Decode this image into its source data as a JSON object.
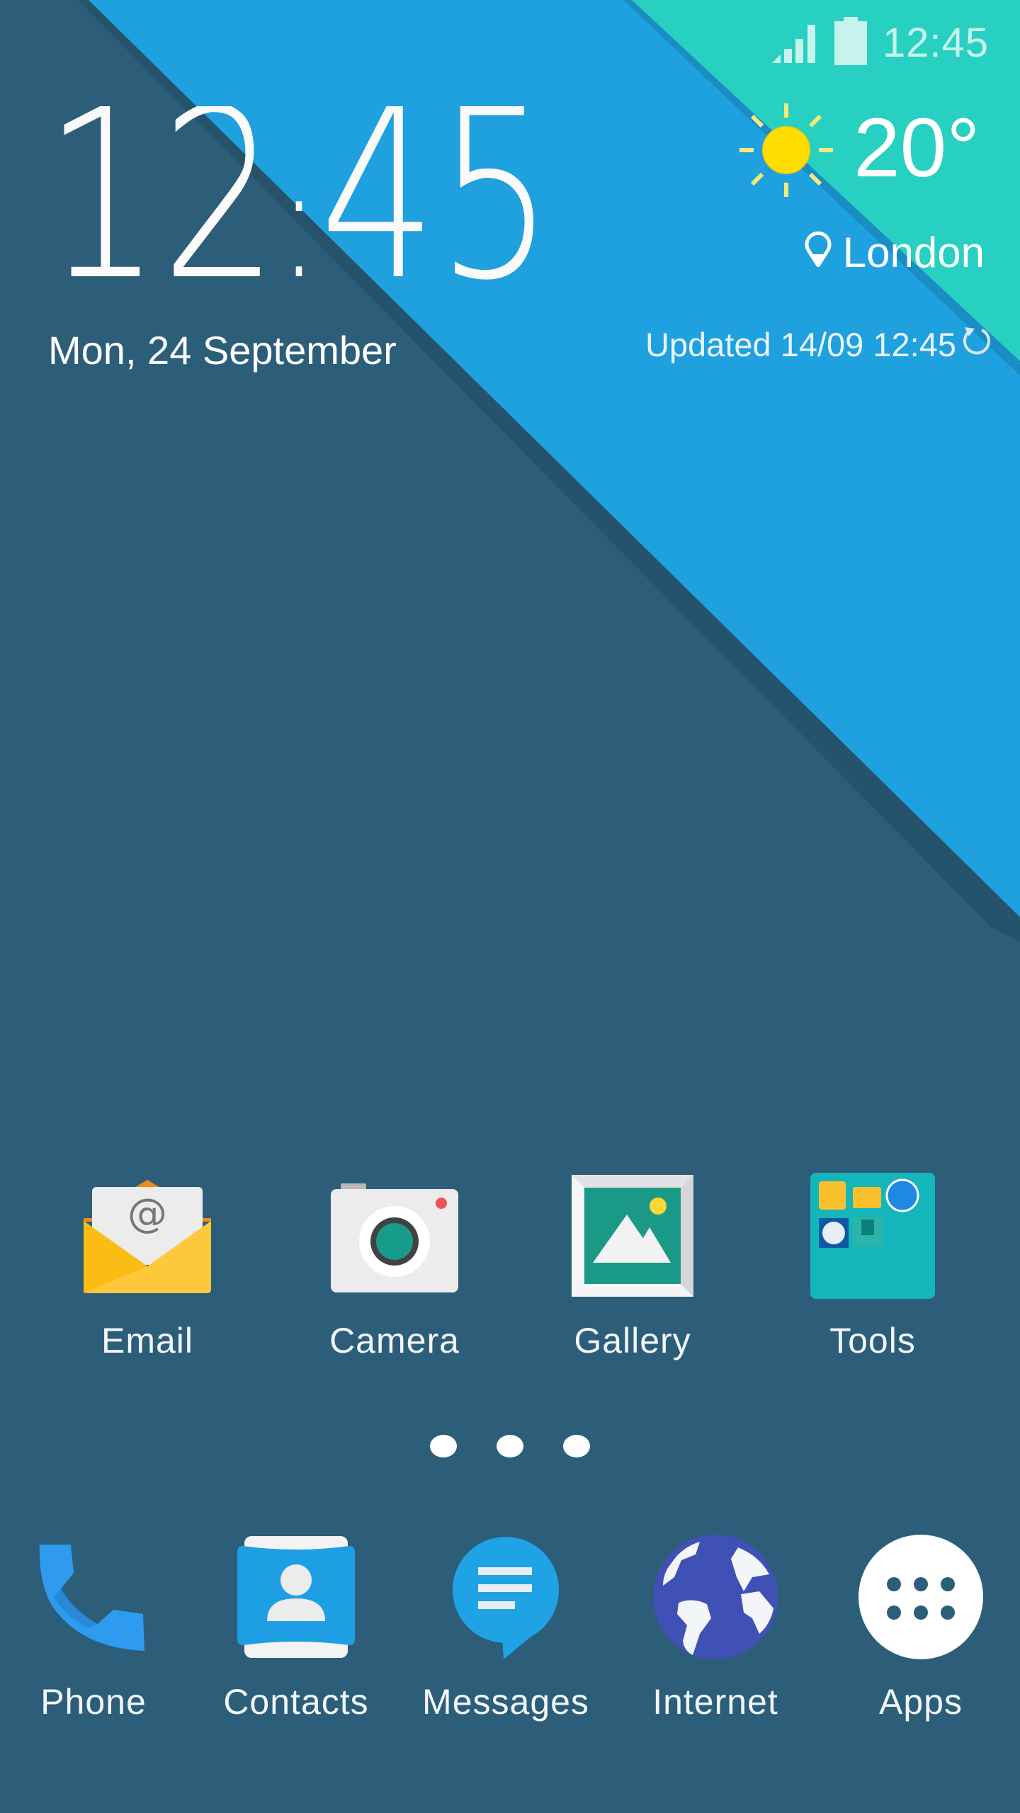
{
  "status_bar": {
    "signal_icon": "signal-strength-icon",
    "battery_icon": "battery-full-icon",
    "time": "12:45"
  },
  "clock_widget": {
    "time_hours": "12",
    "time_separator": ":",
    "time_minutes": "45",
    "date": "Mon, 24 September"
  },
  "weather_widget": {
    "condition_icon": "sunny-icon",
    "temperature": "20°",
    "location_icon": "location-pin-icon",
    "location": "London",
    "updated_text": "Updated 14/09 12:45",
    "refresh_icon": "refresh-icon"
  },
  "home_apps": [
    {
      "label": "Email",
      "icon": "email-icon"
    },
    {
      "label": "Camera",
      "icon": "camera-icon"
    },
    {
      "label": "Gallery",
      "icon": "gallery-icon"
    },
    {
      "label": "Tools",
      "icon": "folder-icon"
    }
  ],
  "page_indicator": {
    "pages": 3,
    "current": 1
  },
  "dock": [
    {
      "label": "Phone",
      "icon": "phone-icon"
    },
    {
      "label": "Contacts",
      "icon": "contacts-icon"
    },
    {
      "label": "Messages",
      "icon": "messages-icon"
    },
    {
      "label": "Internet",
      "icon": "internet-globe-icon"
    },
    {
      "label": "Apps",
      "icon": "app-drawer-icon"
    }
  ],
  "colors": {
    "background": "#2c5e7a",
    "stripe_blue": "#1fa0df",
    "stripe_teal": "#27d0c0",
    "sun": "#ffde00"
  }
}
